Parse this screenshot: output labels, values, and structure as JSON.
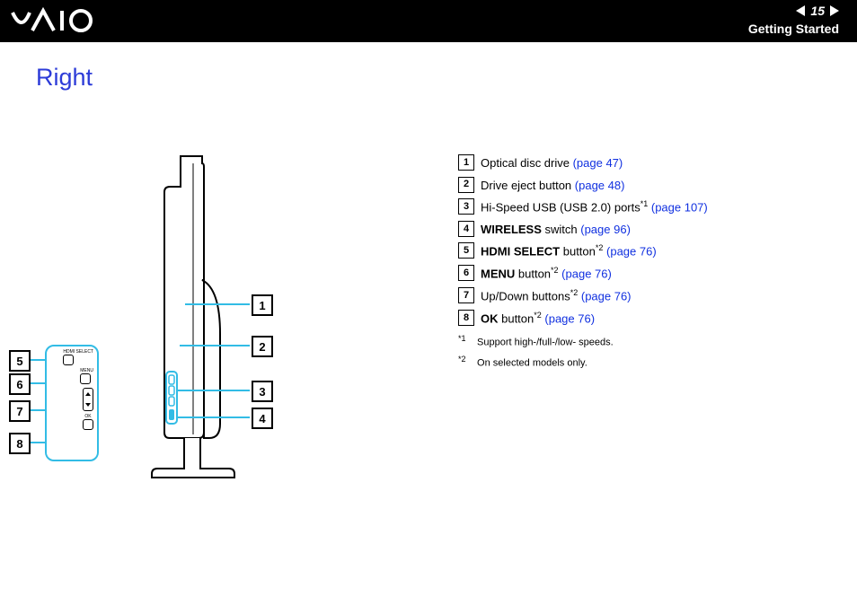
{
  "header": {
    "page_number": "15",
    "section": "Getting Started",
    "logo_alt": "VAIO"
  },
  "title": "Right",
  "legend": {
    "items": [
      {
        "n": "1",
        "pre": "",
        "bold": "",
        "text": "Optical disc drive ",
        "sup": "",
        "link": "(page 47)"
      },
      {
        "n": "2",
        "pre": "",
        "bold": "",
        "text": "Drive eject button ",
        "sup": "",
        "link": "(page 48)"
      },
      {
        "n": "3",
        "pre": "",
        "bold": "",
        "text": "Hi-Speed USB (USB 2.0) ports",
        "sup": "*1",
        "link": " (page 107)"
      },
      {
        "n": "4",
        "pre": "",
        "bold": "WIRELESS",
        "text": " switch ",
        "sup": "",
        "link": "(page 96)"
      },
      {
        "n": "5",
        "pre": "",
        "bold": "HDMI SELECT",
        "text": " button",
        "sup": "*2",
        "link": " (page 76)"
      },
      {
        "n": "6",
        "pre": "",
        "bold": "MENU",
        "text": " button",
        "sup": "*2",
        "link": " (page 76)"
      },
      {
        "n": "7",
        "pre": "",
        "bold": "",
        "text": "Up/Down buttons",
        "sup": "*2",
        "link": " (page 76)"
      },
      {
        "n": "8",
        "pre": "",
        "bold": "OK",
        "text": " button",
        "sup": "*2",
        "link": " (page 76)"
      }
    ],
    "footnotes": [
      {
        "sup": "*1",
        "text": "Support high-/full-/low- speeds."
      },
      {
        "sup": "*2",
        "text": "On selected models only."
      }
    ]
  },
  "panel": {
    "labels": {
      "hdmi": "HDMI\nSELECT",
      "menu": "MENU",
      "ok": "OK"
    }
  },
  "callouts_right": [
    "1",
    "2",
    "3",
    "4"
  ],
  "callouts_left": [
    "5",
    "6",
    "7",
    "8"
  ]
}
